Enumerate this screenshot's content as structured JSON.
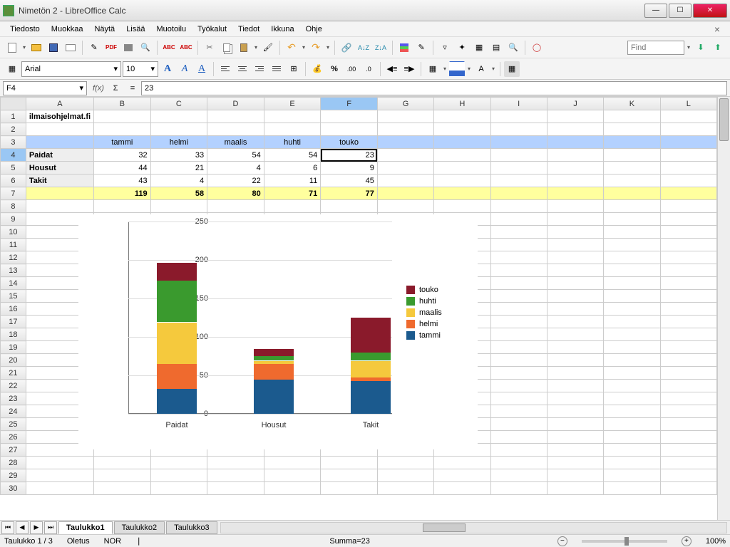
{
  "window": {
    "title": "Nimetön 2 - LibreOffice Calc"
  },
  "menu": [
    "Tiedosto",
    "Muokkaa",
    "Näytä",
    "Lisää",
    "Muotoilu",
    "Työkalut",
    "Tiedot",
    "Ikkuna",
    "Ohje"
  ],
  "find_placeholder": "Find",
  "font": {
    "name": "Arial",
    "size": "10"
  },
  "cellref": "F4",
  "formula": "23",
  "columns": [
    "A",
    "B",
    "C",
    "D",
    "E",
    "F",
    "G",
    "H",
    "I",
    "J",
    "K",
    "L"
  ],
  "active_col": "F",
  "active_row": 4,
  "rows": [
    1,
    2,
    3,
    4,
    5,
    6,
    7,
    8,
    9,
    10,
    11,
    12,
    13,
    14,
    15,
    16,
    17,
    18,
    19,
    20,
    21,
    22,
    23,
    24,
    25,
    26,
    27,
    28,
    29,
    30
  ],
  "a1": "ilmaisohjelmat.fi",
  "header_labels": [
    "tammi",
    "helmi",
    "maalis",
    "huhti",
    "touko"
  ],
  "row_labels": [
    "Paidat",
    "Housut",
    "Takit"
  ],
  "data": [
    [
      32,
      33,
      54,
      54,
      23
    ],
    [
      44,
      21,
      4,
      6,
      9
    ],
    [
      43,
      4,
      22,
      11,
      45
    ]
  ],
  "sums": [
    119,
    58,
    80,
    71,
    77
  ],
  "sheet_tabs": [
    "Taulukko1",
    "Taulukko2",
    "Taulukko3"
  ],
  "active_tab": 0,
  "status": {
    "sheet": "Taulukko 1 / 3",
    "style": "Oletus",
    "mode": "NOR",
    "sum": "Summa=23",
    "zoom": "100%"
  },
  "chart_data": {
    "type": "bar",
    "stacked": true,
    "categories": [
      "Paidat",
      "Housut",
      "Takit"
    ],
    "series": [
      {
        "name": "tammi",
        "values": [
          32,
          44,
          43
        ],
        "color": "#1b5a8e"
      },
      {
        "name": "helmi",
        "values": [
          33,
          21,
          4
        ],
        "color": "#ef6a2e"
      },
      {
        "name": "maalis",
        "values": [
          54,
          4,
          22
        ],
        "color": "#f5c93d"
      },
      {
        "name": "huhti",
        "values": [
          54,
          6,
          11
        ],
        "color": "#3a9a2e"
      },
      {
        "name": "touko",
        "values": [
          23,
          9,
          45
        ],
        "color": "#8a1a2b"
      }
    ],
    "ylim": [
      0,
      250
    ],
    "yticks": [
      0,
      50,
      100,
      150,
      200,
      250
    ],
    "legend_position": "right"
  }
}
